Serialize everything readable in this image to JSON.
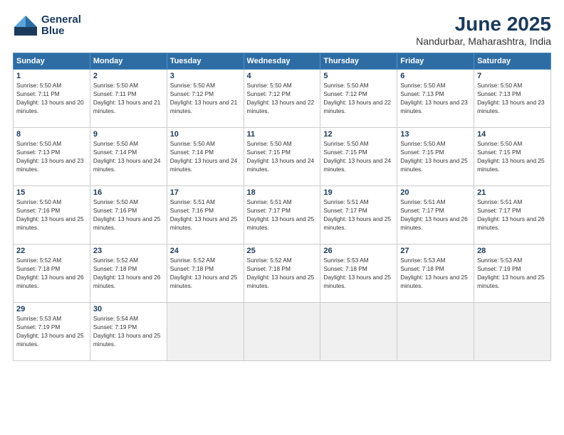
{
  "logo": {
    "line1": "General",
    "line2": "Blue"
  },
  "title": "June 2025",
  "subtitle": "Nandurbar, Maharashtra, India",
  "headers": [
    "Sunday",
    "Monday",
    "Tuesday",
    "Wednesday",
    "Thursday",
    "Friday",
    "Saturday"
  ],
  "weeks": [
    [
      {
        "day": "1",
        "sunrise": "5:50 AM",
        "sunset": "7:11 PM",
        "daylight": "13 hours and 20 minutes."
      },
      {
        "day": "2",
        "sunrise": "5:50 AM",
        "sunset": "7:11 PM",
        "daylight": "13 hours and 21 minutes."
      },
      {
        "day": "3",
        "sunrise": "5:50 AM",
        "sunset": "7:12 PM",
        "daylight": "13 hours and 21 minutes."
      },
      {
        "day": "4",
        "sunrise": "5:50 AM",
        "sunset": "7:12 PM",
        "daylight": "13 hours and 22 minutes."
      },
      {
        "day": "5",
        "sunrise": "5:50 AM",
        "sunset": "7:12 PM",
        "daylight": "13 hours and 22 minutes."
      },
      {
        "day": "6",
        "sunrise": "5:50 AM",
        "sunset": "7:13 PM",
        "daylight": "13 hours and 23 minutes."
      },
      {
        "day": "7",
        "sunrise": "5:50 AM",
        "sunset": "7:13 PM",
        "daylight": "13 hours and 23 minutes."
      }
    ],
    [
      {
        "day": "8",
        "sunrise": "5:50 AM",
        "sunset": "7:13 PM",
        "daylight": "13 hours and 23 minutes."
      },
      {
        "day": "9",
        "sunrise": "5:50 AM",
        "sunset": "7:14 PM",
        "daylight": "13 hours and 24 minutes."
      },
      {
        "day": "10",
        "sunrise": "5:50 AM",
        "sunset": "7:14 PM",
        "daylight": "13 hours and 24 minutes."
      },
      {
        "day": "11",
        "sunrise": "5:50 AM",
        "sunset": "7:15 PM",
        "daylight": "13 hours and 24 minutes."
      },
      {
        "day": "12",
        "sunrise": "5:50 AM",
        "sunset": "7:15 PM",
        "daylight": "13 hours and 24 minutes."
      },
      {
        "day": "13",
        "sunrise": "5:50 AM",
        "sunset": "7:15 PM",
        "daylight": "13 hours and 25 minutes."
      },
      {
        "day": "14",
        "sunrise": "5:50 AM",
        "sunset": "7:15 PM",
        "daylight": "13 hours and 25 minutes."
      }
    ],
    [
      {
        "day": "15",
        "sunrise": "5:50 AM",
        "sunset": "7:16 PM",
        "daylight": "13 hours and 25 minutes."
      },
      {
        "day": "16",
        "sunrise": "5:50 AM",
        "sunset": "7:16 PM",
        "daylight": "13 hours and 25 minutes."
      },
      {
        "day": "17",
        "sunrise": "5:51 AM",
        "sunset": "7:16 PM",
        "daylight": "13 hours and 25 minutes."
      },
      {
        "day": "18",
        "sunrise": "5:51 AM",
        "sunset": "7:17 PM",
        "daylight": "13 hours and 25 minutes."
      },
      {
        "day": "19",
        "sunrise": "5:51 AM",
        "sunset": "7:17 PM",
        "daylight": "13 hours and 25 minutes."
      },
      {
        "day": "20",
        "sunrise": "5:51 AM",
        "sunset": "7:17 PM",
        "daylight": "13 hours and 26 minutes."
      },
      {
        "day": "21",
        "sunrise": "5:51 AM",
        "sunset": "7:17 PM",
        "daylight": "13 hours and 26 minutes."
      }
    ],
    [
      {
        "day": "22",
        "sunrise": "5:52 AM",
        "sunset": "7:18 PM",
        "daylight": "13 hours and 26 minutes."
      },
      {
        "day": "23",
        "sunrise": "5:52 AM",
        "sunset": "7:18 PM",
        "daylight": "13 hours and 26 minutes."
      },
      {
        "day": "24",
        "sunrise": "5:52 AM",
        "sunset": "7:18 PM",
        "daylight": "13 hours and 25 minutes."
      },
      {
        "day": "25",
        "sunrise": "5:52 AM",
        "sunset": "7:18 PM",
        "daylight": "13 hours and 25 minutes."
      },
      {
        "day": "26",
        "sunrise": "5:53 AM",
        "sunset": "7:18 PM",
        "daylight": "13 hours and 25 minutes."
      },
      {
        "day": "27",
        "sunrise": "5:53 AM",
        "sunset": "7:18 PM",
        "daylight": "13 hours and 25 minutes."
      },
      {
        "day": "28",
        "sunrise": "5:53 AM",
        "sunset": "7:19 PM",
        "daylight": "13 hours and 25 minutes."
      }
    ],
    [
      {
        "day": "29",
        "sunrise": "5:53 AM",
        "sunset": "7:19 PM",
        "daylight": "13 hours and 25 minutes."
      },
      {
        "day": "30",
        "sunrise": "5:54 AM",
        "sunset": "7:19 PM",
        "daylight": "13 hours and 25 minutes."
      },
      null,
      null,
      null,
      null,
      null
    ]
  ]
}
